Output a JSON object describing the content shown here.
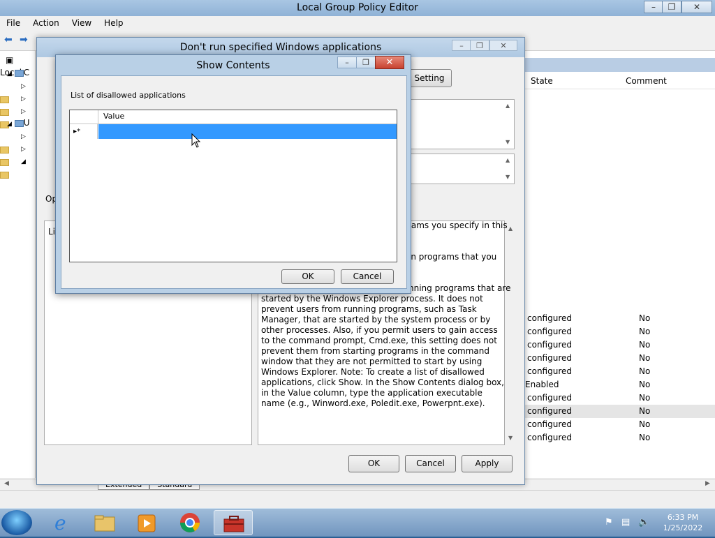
{
  "main_window": {
    "title": "Local Group Policy Editor",
    "caption_buttons": {
      "minimize": "–",
      "restore": "❐",
      "close": "✕"
    },
    "menu": [
      "File",
      "Action",
      "View",
      "Help"
    ],
    "tree_items": [
      "Local",
      "C",
      "",
      "",
      "",
      "U",
      "",
      "",
      ""
    ],
    "list_header": {
      "state": "State",
      "comment": "Comment"
    },
    "rows": [
      {
        "state": "configured",
        "comment": "No"
      },
      {
        "state": "configured",
        "comment": "No"
      },
      {
        "state": "configured",
        "comment": "No"
      },
      {
        "state": "configured",
        "comment": "No"
      },
      {
        "state": "configured",
        "comment": "No"
      },
      {
        "state": "Enabled",
        "comment": "No"
      },
      {
        "state": "configured",
        "comment": "No"
      },
      {
        "state": "configured",
        "comment": "No",
        "selected": true
      },
      {
        "state": "configured",
        "comment": "No"
      },
      {
        "state": "configured",
        "comment": "No"
      }
    ],
    "tabs": [
      "Extended",
      "Standard"
    ]
  },
  "policy_dialog": {
    "title": "Don't run specified Windows applications",
    "setting_button": "Setting",
    "options_label": "Op",
    "list_label": "Li",
    "help_fragments": [
      "ograms you specify in this",
      "in programs that you",
      "nning programs that are"
    ],
    "help_text": "started by the Windows Explorer process. It does not prevent users from running programs, such as Task Manager, that are started by the system process or by other processes. Also, if you permit users to gain access to the command prompt, Cmd.exe, this setting does not prevent them from starting programs in the command window that they are not permitted to start by using Windows Explorer. Note: To create a list of disallowed applications, click Show. In the Show Contents dialog box, in the Value column, type the application executable name (e.g., Winword.exe, Poledit.exe, Powerpnt.exe).",
    "buttons": {
      "ok": "OK",
      "cancel": "Cancel",
      "apply": "Apply"
    }
  },
  "show_contents": {
    "title": "Show Contents",
    "label": "List of disallowed applications",
    "column": "Value",
    "new_row_marker": "▸*",
    "new_row_value": "",
    "buttons": {
      "ok": "OK",
      "cancel": "Cancel"
    },
    "close_glyph": "✕"
  },
  "taskbar": {
    "time": "6:33 PM",
    "date": "1/25/2022",
    "apps": [
      "internet-explorer",
      "file-explorer",
      "media-player",
      "chrome",
      "group-policy-editor"
    ]
  }
}
